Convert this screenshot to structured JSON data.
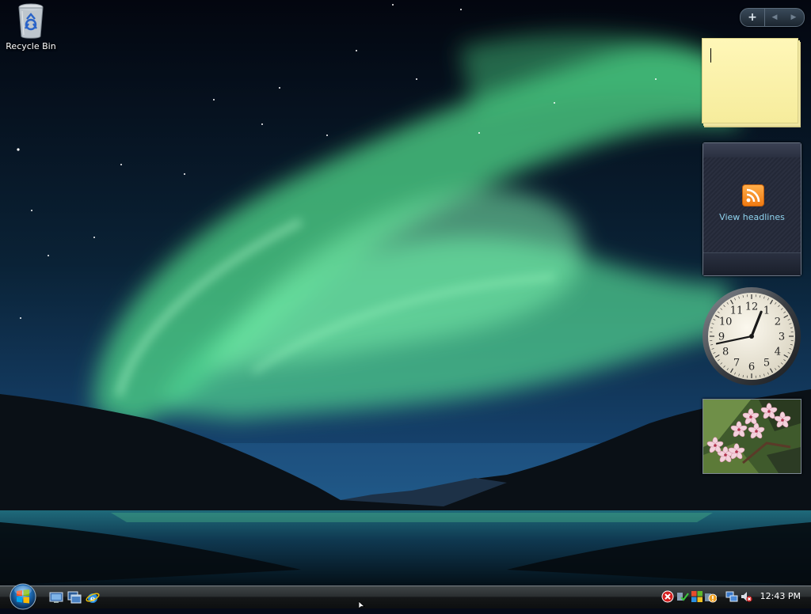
{
  "desktop": {
    "icons": [
      {
        "label": "Recycle Bin",
        "icon": "recycle-bin-icon"
      }
    ]
  },
  "sidebar": {
    "controls": {
      "add": "+",
      "prev": "◀",
      "next": "▶"
    },
    "gadgets": {
      "notes": {
        "text": ""
      },
      "feed": {
        "label": "View headlines",
        "icon": "rss-icon"
      },
      "clock": {
        "time": "12:43",
        "numerals": [
          "12",
          "1",
          "2",
          "3",
          "4",
          "5",
          "6",
          "7",
          "8",
          "9",
          "10",
          "11"
        ]
      },
      "slideshow": {
        "subject": "pink flowers"
      }
    }
  },
  "taskbar": {
    "start": {
      "icon": "windows-start-orb"
    },
    "quick_launch": [
      {
        "name": "show-desktop-icon"
      },
      {
        "name": "switch-windows-icon"
      },
      {
        "name": "internet-explorer-icon"
      }
    ],
    "tray": {
      "icons": [
        "security-alert-icon",
        "network-check-icon",
        "windows-update-icon",
        "warning-icon",
        "network-icon",
        "volume-muted-icon"
      ],
      "clock": "12:43 PM"
    }
  },
  "colors": {
    "aurora": "#5fe08f",
    "sky_top": "#050a18",
    "taskbar": "#1b1e20"
  }
}
